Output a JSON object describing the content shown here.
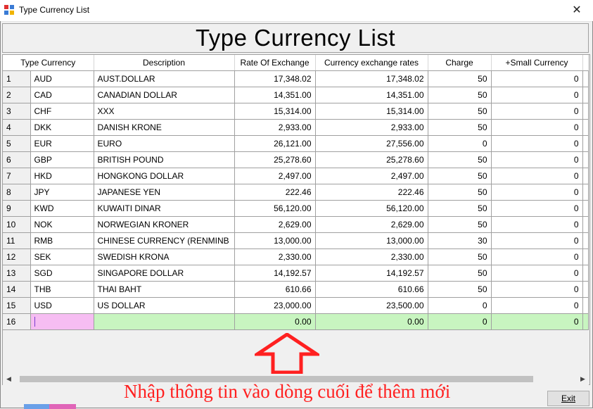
{
  "window": {
    "title": "Type Currency List"
  },
  "header": {
    "title": "Type Currency List"
  },
  "grid": {
    "columns": [
      "Type Currency",
      "Description",
      "Rate Of Exchange",
      "Currency exchange rates",
      "Charge",
      "+Small Currency"
    ],
    "rows": [
      {
        "n": "1",
        "code": "AUD",
        "desc": "AUST.DOLLAR",
        "rate": "17,348.02",
        "fx": "17,348.02",
        "charge": "50",
        "small": "0"
      },
      {
        "n": "2",
        "code": "CAD",
        "desc": "CANADIAN DOLLAR",
        "rate": "14,351.00",
        "fx": "14,351.00",
        "charge": "50",
        "small": "0"
      },
      {
        "n": "3",
        "code": "CHF",
        "desc": "XXX",
        "rate": "15,314.00",
        "fx": "15,314.00",
        "charge": "50",
        "small": "0"
      },
      {
        "n": "4",
        "code": "DKK",
        "desc": "DANISH KRONE",
        "rate": "2,933.00",
        "fx": "2,933.00",
        "charge": "50",
        "small": "0"
      },
      {
        "n": "5",
        "code": "EUR",
        "desc": "EURO",
        "rate": "26,121.00",
        "fx": "27,556.00",
        "charge": "0",
        "small": "0"
      },
      {
        "n": "6",
        "code": "GBP",
        "desc": "BRITISH POUND",
        "rate": "25,278.60",
        "fx": "25,278.60",
        "charge": "50",
        "small": "0"
      },
      {
        "n": "7",
        "code": "HKD",
        "desc": "HONGKONG DOLLAR",
        "rate": "2,497.00",
        "fx": "2,497.00",
        "charge": "50",
        "small": "0"
      },
      {
        "n": "8",
        "code": "JPY",
        "desc": "JAPANESE YEN",
        "rate": "222.46",
        "fx": "222.46",
        "charge": "50",
        "small": "0"
      },
      {
        "n": "9",
        "code": "KWD",
        "desc": "KUWAITI DINAR",
        "rate": "56,120.00",
        "fx": "56,120.00",
        "charge": "50",
        "small": "0"
      },
      {
        "n": "10",
        "code": "NOK",
        "desc": "NORWEGIAN KRONER",
        "rate": "2,629.00",
        "fx": "2,629.00",
        "charge": "50",
        "small": "0"
      },
      {
        "n": "11",
        "code": "RMB",
        "desc": "CHINESE CURRENCY (RENMINB",
        "rate": "13,000.00",
        "fx": "13,000.00",
        "charge": "30",
        "small": "0"
      },
      {
        "n": "12",
        "code": "SEK",
        "desc": "SWEDISH KRONA",
        "rate": "2,330.00",
        "fx": "2,330.00",
        "charge": "50",
        "small": "0"
      },
      {
        "n": "13",
        "code": "SGD",
        "desc": "SINGAPORE DOLLAR",
        "rate": "14,192.57",
        "fx": "14,192.57",
        "charge": "50",
        "small": "0"
      },
      {
        "n": "14",
        "code": "THB",
        "desc": "THAI BAHT",
        "rate": "610.66",
        "fx": "610.66",
        "charge": "50",
        "small": "0"
      },
      {
        "n": "15",
        "code": "USD",
        "desc": "US DOLLAR",
        "rate": "23,000.00",
        "fx": "23,500.00",
        "charge": "0",
        "small": "0"
      }
    ],
    "new_row": {
      "n": "16",
      "code": "",
      "desc": "",
      "rate": "0.00",
      "fx": "0.00",
      "charge": "0",
      "small": "0"
    }
  },
  "note": "Nhập thông tin vào dòng cuối để thêm mới",
  "buttons": {
    "exit": "Exit",
    "close": "✕"
  },
  "colors": {
    "new_row": "#c8f5c0",
    "new_cell": "#f6bdf2",
    "note": "#ff2020",
    "arrow": "#ff2020"
  }
}
